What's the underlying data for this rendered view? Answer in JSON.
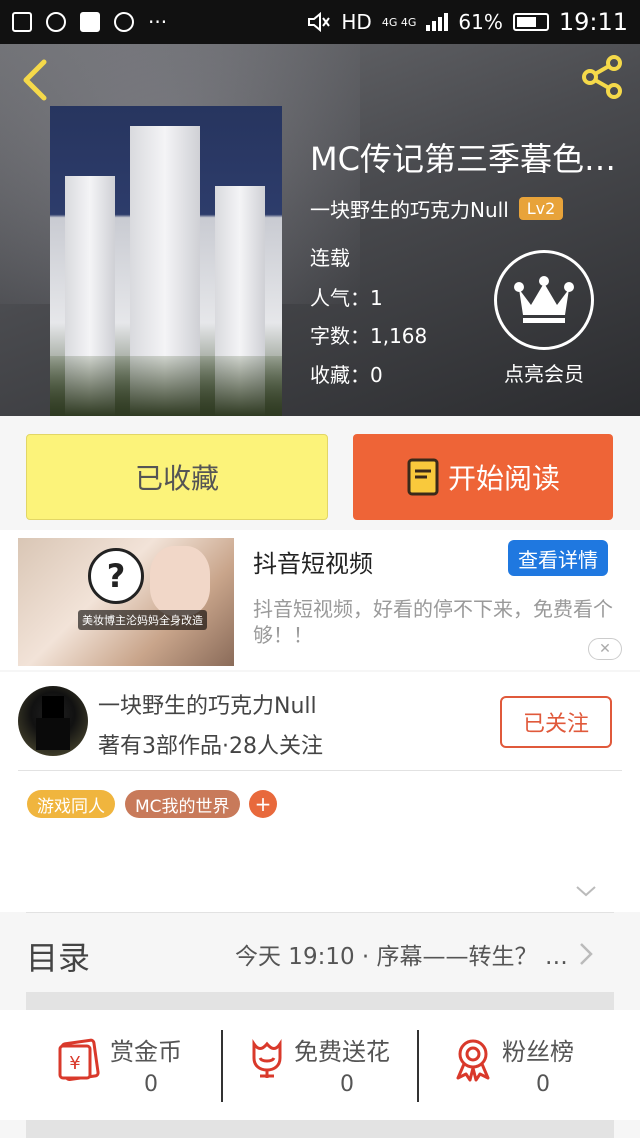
{
  "status_bar": {
    "network": "HD",
    "network_type": "4G 4G",
    "battery": "61%",
    "time": "19:11"
  },
  "book": {
    "title": "MC传记第三季暮色之…",
    "author": "一块野生的巧克力Null",
    "level": "Lv2",
    "status": "连载",
    "popularity_label": "人气：",
    "popularity": "1",
    "words_label": "字数：",
    "words": "1,168",
    "favorites_label": "收藏：",
    "favorites": "0",
    "vip_label": "点亮会员"
  },
  "buttons": {
    "collected": "已收藏",
    "start_reading": "开始阅读"
  },
  "ad": {
    "title": "抖音短视频",
    "detail_button": "查看详情",
    "description": "抖音短视频，好看的停不下来，免费看个够！！",
    "image_caption": "美妆博主沦妈妈全身改造"
  },
  "author_card": {
    "name": "一块野生的巧克力Null",
    "stats": "著有3部作品·28人关注",
    "follow_button": "已关注"
  },
  "tags": [
    "游戏同人",
    "MC我的世界",
    "+"
  ],
  "toc": {
    "label": "目录",
    "latest": "今天 19:10 · 序幕——转生？ …"
  },
  "actions": [
    {
      "label": "赏金币",
      "count": "0"
    },
    {
      "label": "免费送花",
      "count": "0"
    },
    {
      "label": "粉丝榜",
      "count": "0"
    }
  ],
  "colors": {
    "accent_orange": "#ee6437",
    "collected_yellow": "#fcf37a",
    "ad_blue": "#1f78e0",
    "level_badge": "#e8a33a",
    "icon_red": "#d9392b"
  }
}
